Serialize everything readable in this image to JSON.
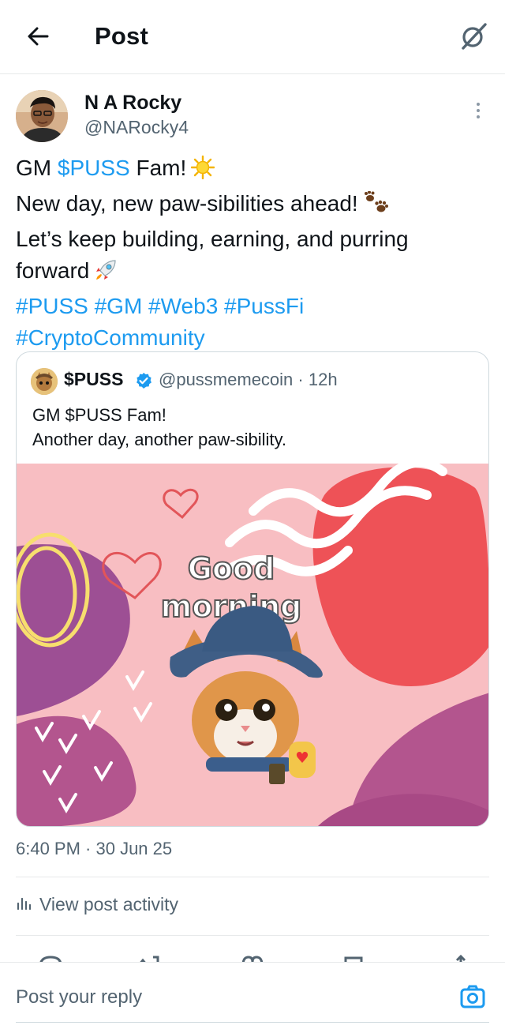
{
  "header": {
    "title": "Post",
    "back_icon": "arrow-left-icon",
    "grok_icon": "grok-icon"
  },
  "post": {
    "author": {
      "name": "N A Rocky",
      "handle": "@NARocky4"
    },
    "lines": [
      {
        "parts": [
          {
            "t": "GM "
          },
          {
            "t": "$PUSS",
            "link": true
          },
          {
            "t": " Fam!"
          }
        ],
        "emoji": "sun-emoji"
      },
      {
        "parts": [
          {
            "t": "New day, new paw-sibilities ahead!"
          }
        ],
        "emoji": "paw-prints-emoji"
      },
      {
        "parts": [
          {
            "t": "Let’s keep building, earning, and purring"
          }
        ]
      },
      {
        "parts": [
          {
            "t": "forward"
          }
        ],
        "emoji": "rocket-emoji"
      },
      {
        "parts": [
          {
            "t": "#PUSS #GM #Web3 #PussFi",
            "link": true
          }
        ]
      },
      {
        "parts": [
          {
            "t": "#CryptoCommunity",
            "link": true
          }
        ]
      }
    ],
    "timestamp": "6:40 PM · 30 Jun 25",
    "activity_label": "View post activity"
  },
  "quote": {
    "name": "$PUSS",
    "verified": true,
    "handle": "@pussmemecoin",
    "age": "· 12h",
    "lines": [
      "GM $PUSS Fam!",
      "Another day, another paw-sibility."
    ],
    "media": {
      "line1": "Good",
      "line2": "morning"
    }
  },
  "reply": {
    "placeholder": "Post your reply",
    "camera_icon": "camera-icon"
  },
  "colors": {
    "link": "#1d9bf0",
    "muted": "#536471",
    "border": "#cfd9de",
    "verified": "#1d9bf0"
  }
}
